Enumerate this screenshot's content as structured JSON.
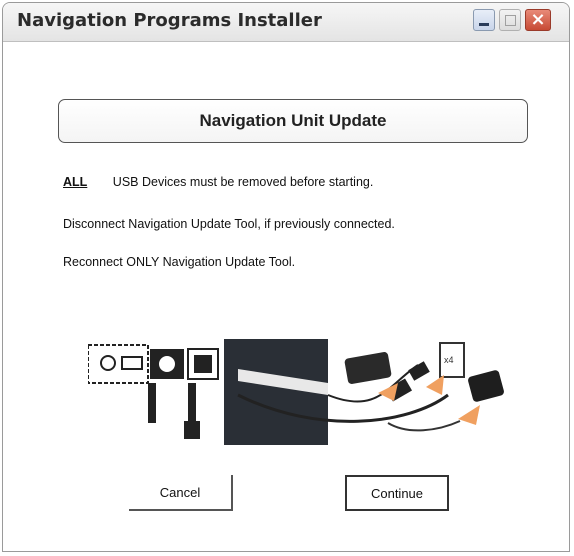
{
  "window": {
    "title": "Navigation Programs Installer"
  },
  "header": {
    "title": "Navigation Unit Update"
  },
  "instructions": {
    "line1_emphasis": "ALL",
    "line1_text": "USB Devices must be removed before starting.",
    "line2": "Disconnect Navigation Update Tool, if previously connected.",
    "line3": "Reconnect ONLY Navigation Update Tool."
  },
  "illustration": {
    "icon": "usb-connection-diagram",
    "label_on_plug": "x4"
  },
  "buttons": {
    "cancel": "Cancel",
    "continue": "Continue"
  },
  "colors": {
    "close_button": "#c74a34",
    "arrow": "#f0a060"
  }
}
